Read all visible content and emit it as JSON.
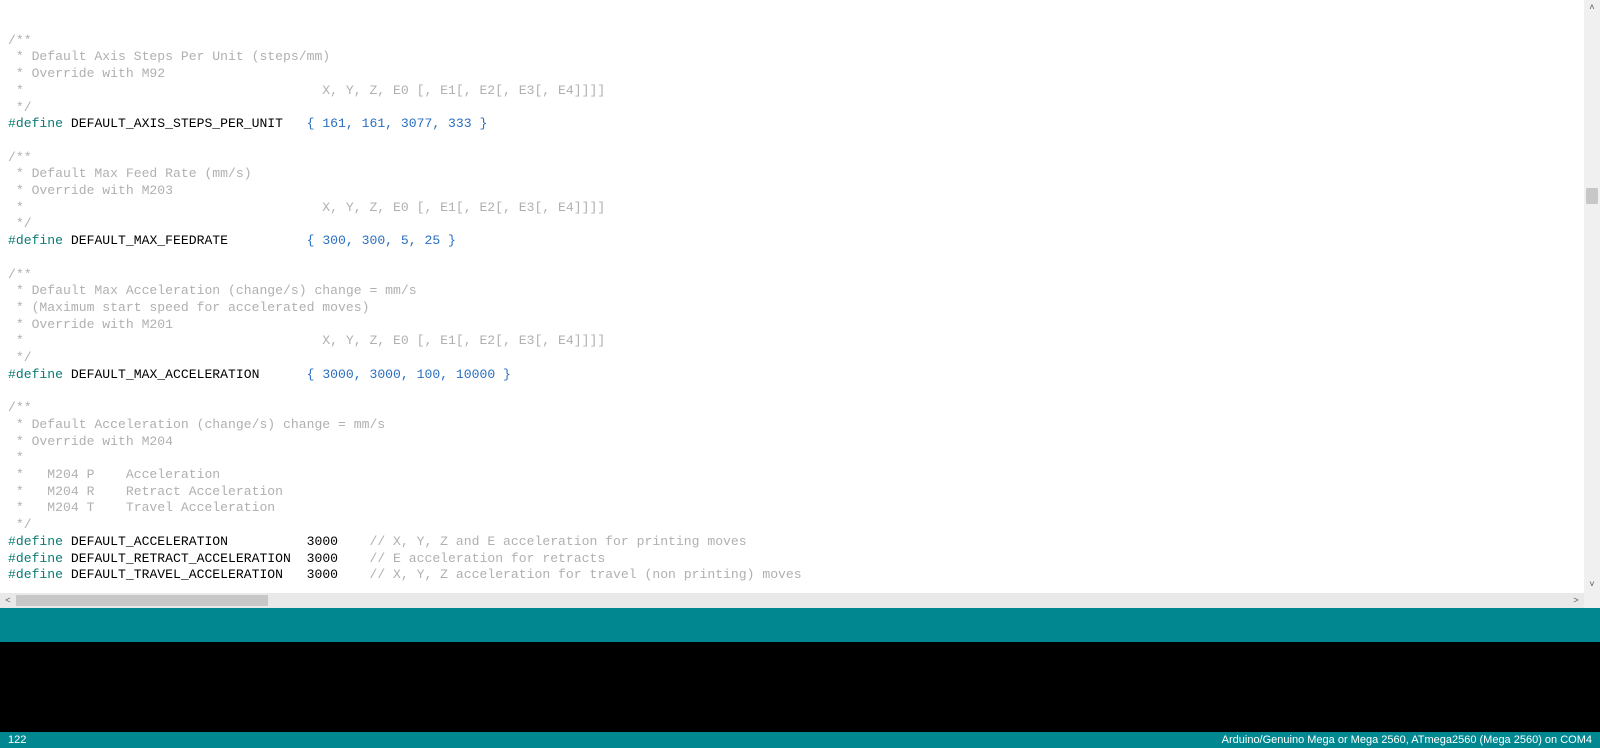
{
  "code": {
    "block1": {
      "c1": "/**",
      "c2": " * Default Axis Steps Per Unit (steps/mm)",
      "c3": " * Override with M92",
      "c4": " *                                      X, Y, Z, E0 [, E1[, E2[, E3[, E4]]]]",
      "c5": " */",
      "kw": "#define",
      "id": " DEFAULT_AXIS_STEPS_PER_UNIT   ",
      "val": "{ 161, 161, 3077, 333 }"
    },
    "block2": {
      "c1": "/**",
      "c2": " * Default Max Feed Rate (mm/s)",
      "c3": " * Override with M203",
      "c4": " *                                      X, Y, Z, E0 [, E1[, E2[, E3[, E4]]]]",
      "c5": " */",
      "kw": "#define",
      "id": " DEFAULT_MAX_FEEDRATE          ",
      "val": "{ 300, 300, 5, 25 }"
    },
    "block3": {
      "c1": "/**",
      "c2": " * Default Max Acceleration (change/s) change = mm/s",
      "c3": " * (Maximum start speed for accelerated moves)",
      "c4": " * Override with M201",
      "c5": " *                                      X, Y, Z, E0 [, E1[, E2[, E3[, E4]]]]",
      "c6": " */",
      "kw": "#define",
      "id": " DEFAULT_MAX_ACCELERATION      ",
      "val": "{ 3000, 3000, 100, 10000 }"
    },
    "block4": {
      "c1": "/**",
      "c2": " * Default Acceleration (change/s) change = mm/s",
      "c3": " * Override with M204",
      "c4": " *",
      "c5": " *   M204 P    Acceleration",
      "c6": " *   M204 R    Retract Acceleration",
      "c7": " *   M204 T    Travel Acceleration",
      "c8": " */",
      "l1": {
        "kw": "#define",
        "id": " DEFAULT_ACCELERATION          3000    ",
        "cm": "// X, Y, Z and E acceleration for printing moves"
      },
      "l2": {
        "kw": "#define",
        "id": " DEFAULT_RETRACT_ACCELERATION  3000    ",
        "cm": "// E acceleration for retracts"
      },
      "l3": {
        "kw": "#define",
        "id": " DEFAULT_TRAVEL_ACCELERATION   3000    ",
        "cm": "// X, Y, Z acceleration for travel (non printing) moves"
      }
    },
    "tail": "/**"
  },
  "scroll": {
    "v_up": "˄",
    "v_down": "˅",
    "h_left": "˂",
    "h_right": "˃"
  },
  "status": {
    "line": "122",
    "board": "Arduino/Genuino Mega or Mega 2560, ATmega2560 (Mega 2560) on COM4"
  },
  "colors": {
    "teal": "#00878F",
    "comment": "#b0b0b0",
    "keyword": "#0b7a75",
    "brace": "#2a6fbf"
  }
}
